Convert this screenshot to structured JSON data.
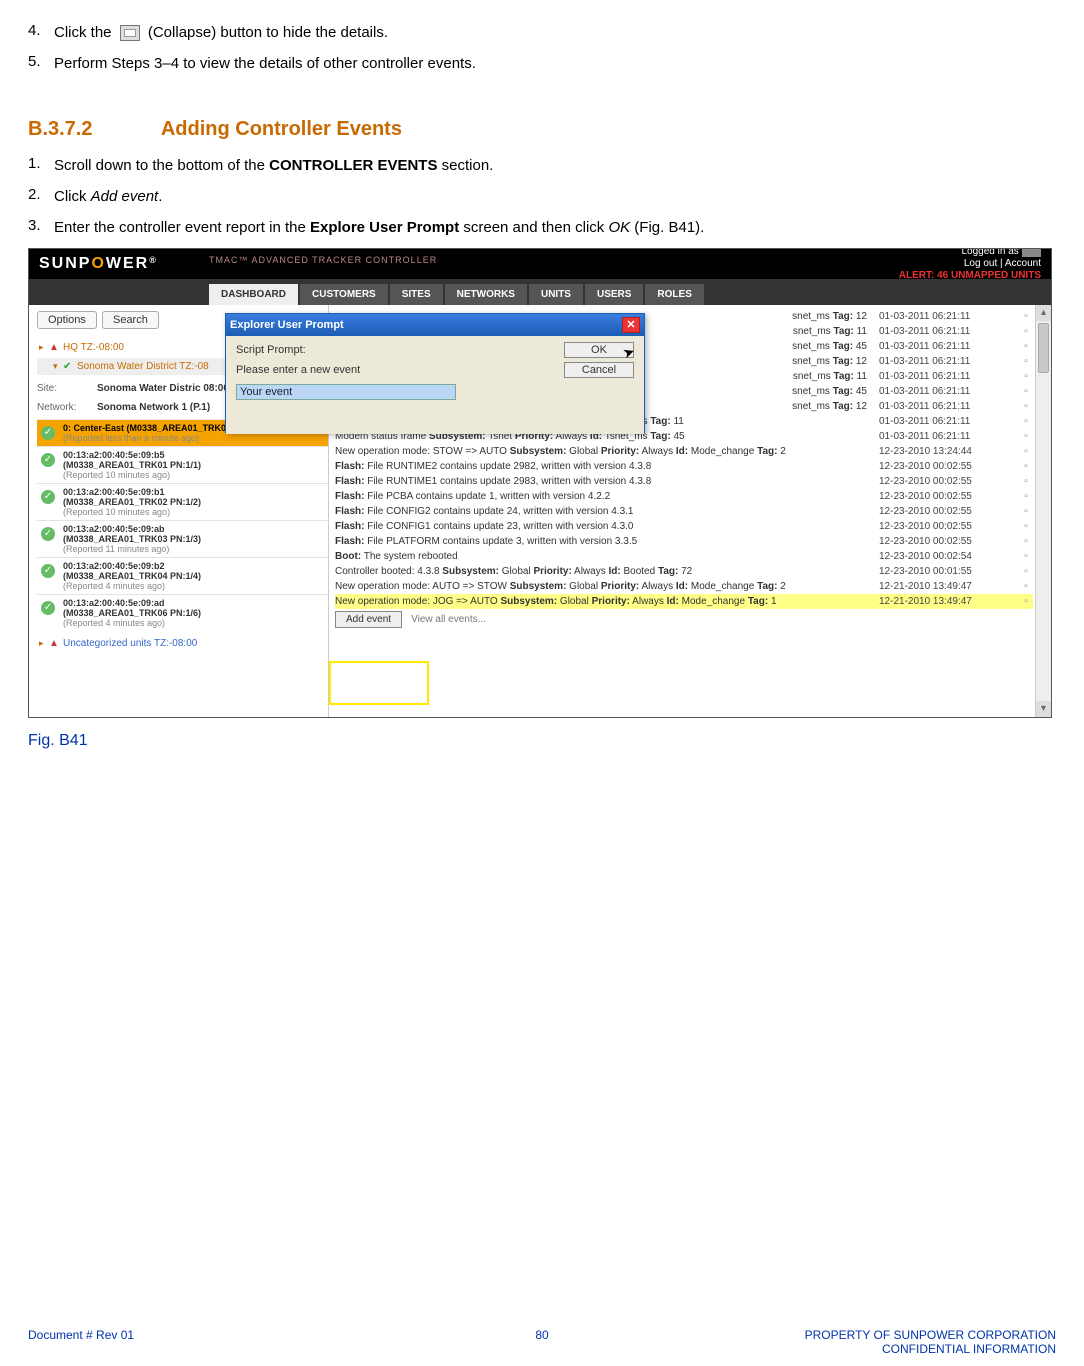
{
  "steps_top": {
    "s4_num": "4.",
    "s4_a": "Click the ",
    "s4_b": " (Collapse) button to hide the details.",
    "s5_num": "5.",
    "s5": "Perform Steps 3–4 to view the details of other controller events."
  },
  "section": {
    "num": "B.3.7.2",
    "title": "Adding Controller Events"
  },
  "steps_add": {
    "s1_num": "1.",
    "s1_a": "Scroll down to the bottom of the ",
    "s1_b": "CONTROLLER EVENTS",
    "s1_c": " section.",
    "s2_num": "2.",
    "s2_a": "Click ",
    "s2_b": "Add event",
    "s2_c": ".",
    "s3_num": "3.",
    "s3_a": "Enter the controller event report in the ",
    "s3_b": "Explore User Prompt",
    "s3_c": " screen and then click ",
    "s3_d": "OK",
    "s3_e": " (Fig. B41)."
  },
  "figure_caption": "Fig. B41",
  "app": {
    "logo_1": "SUNP",
    "logo_dot": "O",
    "logo_2": "WER",
    "title": "TMAC™ ADVANCED TRACKER CONTROLLER",
    "logged": "Logged in as",
    "logout": "Log out",
    "account": "Account",
    "alert": "ALERT: 46 UNMAPPED UNITS",
    "tabs": [
      "DASHBOARD",
      "CUSTOMERS",
      "SITES",
      "NETWORKS",
      "UNITS",
      "USERS",
      "ROLES"
    ]
  },
  "sidebar": {
    "options": "Options",
    "search": "Search",
    "hq": "HQ TZ:-08:00",
    "sw": "Sonoma Water District TZ:-08",
    "site_lbl": "Site:",
    "site_val": "Sonoma Water Distric 08:00",
    "net_lbl": "Network:",
    "net_val": "Sonoma Network 1 (P.1)",
    "units": [
      {
        "sel": true,
        "mac": "0: Center-East (M0338_AREA01_TRK05 PN:1/0)",
        "rep": "(Reported less than a minute ago)"
      },
      {
        "mac": "00:13:a2:00:40:5e:09:b5",
        "sub": "(M0338_AREA01_TRK01 PN:1/1)",
        "rep": "(Reported 10 minutes ago)"
      },
      {
        "mac": "00:13:a2:00:40:5e:09:b1",
        "sub": "(M0338_AREA01_TRK02 PN:1/2)",
        "rep": "(Reported 10 minutes ago)"
      },
      {
        "mac": "00:13:a2:00:40:5e:09:ab",
        "sub": "(M0338_AREA01_TRK03 PN:1/3)",
        "rep": "(Reported 11 minutes ago)"
      },
      {
        "mac": "00:13:a2:00:40:5e:09:b2",
        "sub": "(M0338_AREA01_TRK04 PN:1/4)",
        "rep": "(Reported 4 minutes ago)"
      },
      {
        "mac": "00:13:a2:00:40:5e:09:ad",
        "sub": "(M0338_AREA01_TRK06 PN:1/6)",
        "rep": "(Reported 4 minutes ago)"
      }
    ],
    "uncat": "Uncategorized units TZ:-08:00"
  },
  "events_top": [
    {
      "txt": "snet_ms <b>Tag:</b> 12",
      "ts": "01-03-2011 06:21:11"
    },
    {
      "txt": "snet_ms <b>Tag:</b> 11",
      "ts": "01-03-2011 06:21:11"
    },
    {
      "txt": "snet_ms <b>Tag:</b> 45",
      "ts": "01-03-2011 06:21:11"
    },
    {
      "txt": "snet_ms <b>Tag:</b> 12",
      "ts": "01-03-2011 06:21:11"
    },
    {
      "txt": "snet_ms <b>Tag:</b> 11",
      "ts": "01-03-2011 06:21:11"
    },
    {
      "txt": "snet_ms <b>Tag:</b> 45",
      "ts": "01-03-2011 06:21:11"
    },
    {
      "txt": "snet_ms <b>Tag:</b> 12",
      "ts": "01-03-2011 06:21:11"
    }
  ],
  "events": [
    {
      "txt": "Modem status frame <b>Subsystem:</b> Tsnet <b>Priority:</b> Always <b>Id:</b> Tsnet_ms <b>Tag:</b> 11",
      "ts": "01-03-2011 06:21:11"
    },
    {
      "txt": "Modem status frame <b>Subsystem:</b> Tsnet <b>Priority:</b> Always <b>Id:</b> Tsnet_ms <b>Tag:</b> 45",
      "ts": "01-03-2011 06:21:11"
    },
    {
      "txt": "New operation mode: STOW => AUTO <b>Subsystem:</b> Global <b>Priority:</b> Always <b>Id:</b> Mode_change <b>Tag:</b> 2",
      "ts": "12-23-2010 13:24:44"
    },
    {
      "txt": "<b>Flash:</b> File RUNTIME2 contains update 2982, written with version 4.3.8",
      "ts": "12-23-2010 00:02:55"
    },
    {
      "txt": "<b>Flash:</b> File RUNTIME1 contains update 2983, written with version 4.3.8",
      "ts": "12-23-2010 00:02:55"
    },
    {
      "txt": "<b>Flash:</b> File PCBA contains update 1, written with version 4.2.2",
      "ts": "12-23-2010 00:02:55"
    },
    {
      "txt": "<b>Flash:</b> File CONFIG2 contains update 24, written with version 4.3.1",
      "ts": "12-23-2010 00:02:55"
    },
    {
      "txt": "<b>Flash:</b> File CONFIG1 contains update 23, written with version 4.3.0",
      "ts": "12-23-2010 00:02:55"
    },
    {
      "txt": "<b>Flash:</b> File PLATFORM contains update 3, written with version 3.3.5",
      "ts": "12-23-2010 00:02:55"
    },
    {
      "txt": "<b>Boot:</b> The system rebooted",
      "ts": "12-23-2010 00:02:54"
    },
    {
      "txt": "Controller booted: 4.3.8 <b>Subsystem:</b> Global <b>Priority:</b> Always <b>Id:</b> Booted <b>Tag:</b> 72",
      "ts": "12-23-2010 00:01:55"
    },
    {
      "txt": "New operation mode: AUTO => STOW <b>Subsystem:</b> Global <b>Priority:</b> Always <b>Id:</b> Mode_change <b>Tag:</b> 2",
      "ts": "12-21-2010 13:49:47"
    },
    {
      "txt": "New operation mode: JOG => AUTO <b>Subsystem:</b> Global <b>Priority:</b> Always <b>Id:</b> Mode_change <b>Tag:</b> 1",
      "ts": "12-21-2010 13:49:47",
      "hl": true
    }
  ],
  "event_actions": {
    "add": "Add event",
    "view": "View all events..."
  },
  "dialog": {
    "title": "Explorer User Prompt",
    "label1": "Script Prompt:",
    "label2": "Please enter a new event",
    "ok": "OK",
    "cancel": "Cancel",
    "input": "Your event"
  },
  "footer": {
    "left": "Document #  Rev 01",
    "mid": "80",
    "right1": "PROPERTY OF SUNPOWER CORPORATION",
    "right2": "CONFIDENTIAL INFORMATION"
  }
}
